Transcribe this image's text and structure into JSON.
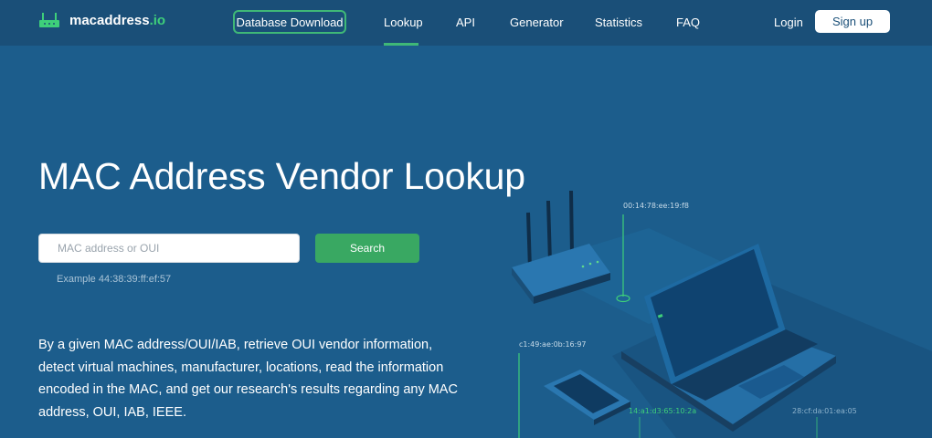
{
  "brand": {
    "name": "macaddress",
    "tld": ".io"
  },
  "nav": {
    "database_download": "Database Download",
    "links": [
      "Lookup",
      "API",
      "Generator",
      "Statistics",
      "FAQ"
    ],
    "login": "Login",
    "signup": "Sign up"
  },
  "hero": {
    "title": "MAC Address Vendor Lookup",
    "search_placeholder": "MAC address or OUI",
    "search_button": "Search",
    "example": "Example 44:38:39:ff:ef:57",
    "description": "By a given MAC address/OUI/IAB, retrieve OUI vendor information, detect virtual machines, manufacturer, locations, read the information encoded in the MAC, and get our research's results regarding any MAC address, OUI, IAB, IEEE."
  },
  "illustration": {
    "labels": [
      "00:14:78:ee:19:f8",
      "c1:49:ae:0b:16:97",
      "14:a1:d3:65:10:2a",
      "28:cf:da:01:ea:05"
    ]
  },
  "colors": {
    "background": "#1c5d8c",
    "navbar": "#1a4f78",
    "accent_green": "#39a862"
  }
}
